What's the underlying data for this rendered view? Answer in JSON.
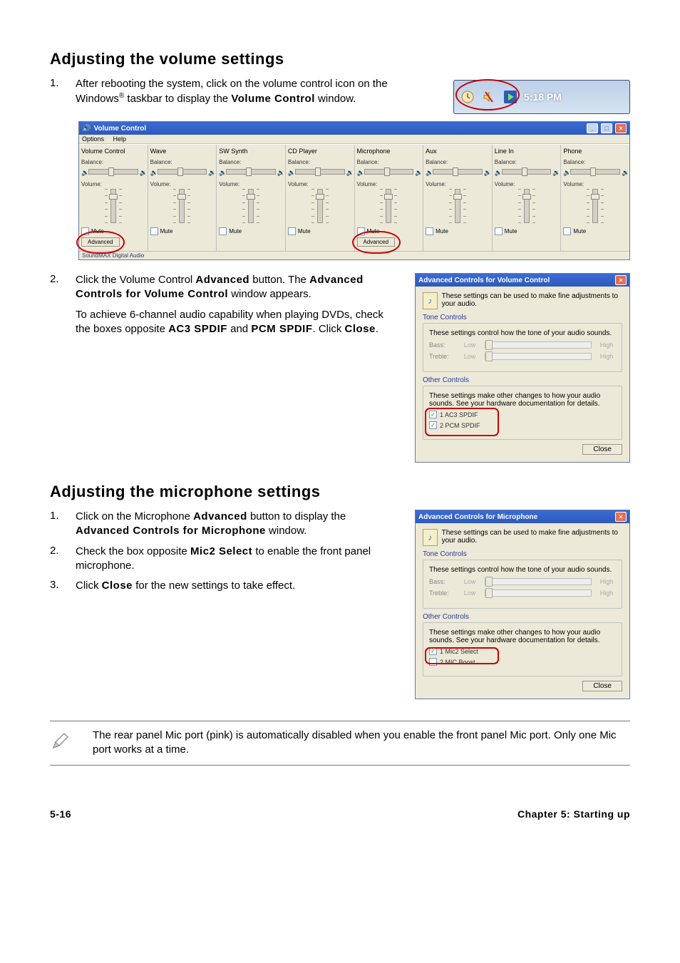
{
  "section1": {
    "heading": "Adjusting the volume settings",
    "step1": {
      "num": "1.",
      "body_pre": "After rebooting the system, click on the volume control icon on the Windows",
      "reg": "®",
      "body_mid": " taskbar to display the ",
      "bold": "Volume Control",
      "body_post": " window."
    },
    "tray_time": "5:18 PM"
  },
  "vc": {
    "title": "Volume Control",
    "menu": [
      "Options",
      "Help"
    ],
    "cols": [
      {
        "name": "Volume Control",
        "balance": "Balance:",
        "volume": "Volume:",
        "mute": "Mute",
        "adv": "Advanced"
      },
      {
        "name": "Wave",
        "balance": "Balance:",
        "volume": "Volume:",
        "mute": "Mute"
      },
      {
        "name": "SW Synth",
        "balance": "Balance:",
        "volume": "Volume:",
        "mute": "Mute"
      },
      {
        "name": "CD Player",
        "balance": "Balance:",
        "volume": "Volume:",
        "mute": "Mute"
      },
      {
        "name": "Microphone",
        "balance": "Balance:",
        "volume": "Volume:",
        "mute": "Mute",
        "adv": "Advanced"
      },
      {
        "name": "Aux",
        "balance": "Balance:",
        "volume": "Volume:",
        "mute": "Mute"
      },
      {
        "name": "Line In",
        "balance": "Balance:",
        "volume": "Volume:",
        "mute": "Mute"
      },
      {
        "name": "Phone",
        "balance": "Balance:",
        "volume": "Volume:",
        "mute": "Mute"
      }
    ],
    "status": "SoundMAX Digital Audio"
  },
  "step2": {
    "num": "2.",
    "p1a": "Click the Volume Control ",
    "p1b": "Advanced",
    "p1c": " button. The ",
    "p1d": "Advanced Controls for Volume Control",
    "p1e": " window appears.",
    "p2a": "To achieve 6-channel audio capability when playing DVDs, check the boxes opposite ",
    "p2b": "AC3 SPDIF",
    "p2c": " and ",
    "p2d": "PCM SPDIF",
    "p2e": ". Click ",
    "p2f": "Close",
    "p2g": "."
  },
  "advVC": {
    "title": "Advanced Controls for Volume Control",
    "intro": "These settings can be used to make fine adjustments to your audio.",
    "tone_label": "Tone Controls",
    "tone_desc": "These settings control how the tone of your audio sounds.",
    "bass": "Bass:",
    "treble": "Treble:",
    "low": "Low",
    "high": "High",
    "other_label": "Other Controls",
    "other_desc": "These settings make other changes to how your audio sounds. See your hardware documentation for details.",
    "opt1": "1  AC3 SPDIF",
    "opt2": "2  PCM SPDIF",
    "close": "Close"
  },
  "section2": {
    "heading": "Adjusting the microphone settings",
    "s1": {
      "num": "1.",
      "a": "Click on the Microphone ",
      "b": "Advanced",
      "c": " button to display the ",
      "d": "Advanced Controls for Microphone",
      "e": " window."
    },
    "s2": {
      "num": "2.",
      "a": "Check the box opposite ",
      "b": "Mic2 Select",
      "c": " to enable the front panel microphone."
    },
    "s3": {
      "num": "3.",
      "a": "Click ",
      "b": "Close",
      "c": " for the new settings to take effect."
    }
  },
  "advMic": {
    "title": "Advanced Controls for Microphone",
    "intro": "These settings can be used to make fine adjustments to your audio.",
    "tone_label": "Tone Controls",
    "tone_desc": "These settings control how the tone of your audio sounds.",
    "bass": "Bass:",
    "treble": "Treble:",
    "low": "Low",
    "high": "High",
    "other_label": "Other Controls",
    "other_desc": "These settings make other changes to how your audio sounds. See your hardware documentation for details.",
    "opt1": "1  Mic2 Select",
    "opt2": "2  MIC Boost",
    "close": "Close"
  },
  "note": "The rear panel Mic port (pink) is automatically disabled when you enable the front panel Mic port. Only one Mic port works at a time.",
  "footer": {
    "left": "5-16",
    "right": "Chapter 5: Starting up"
  }
}
